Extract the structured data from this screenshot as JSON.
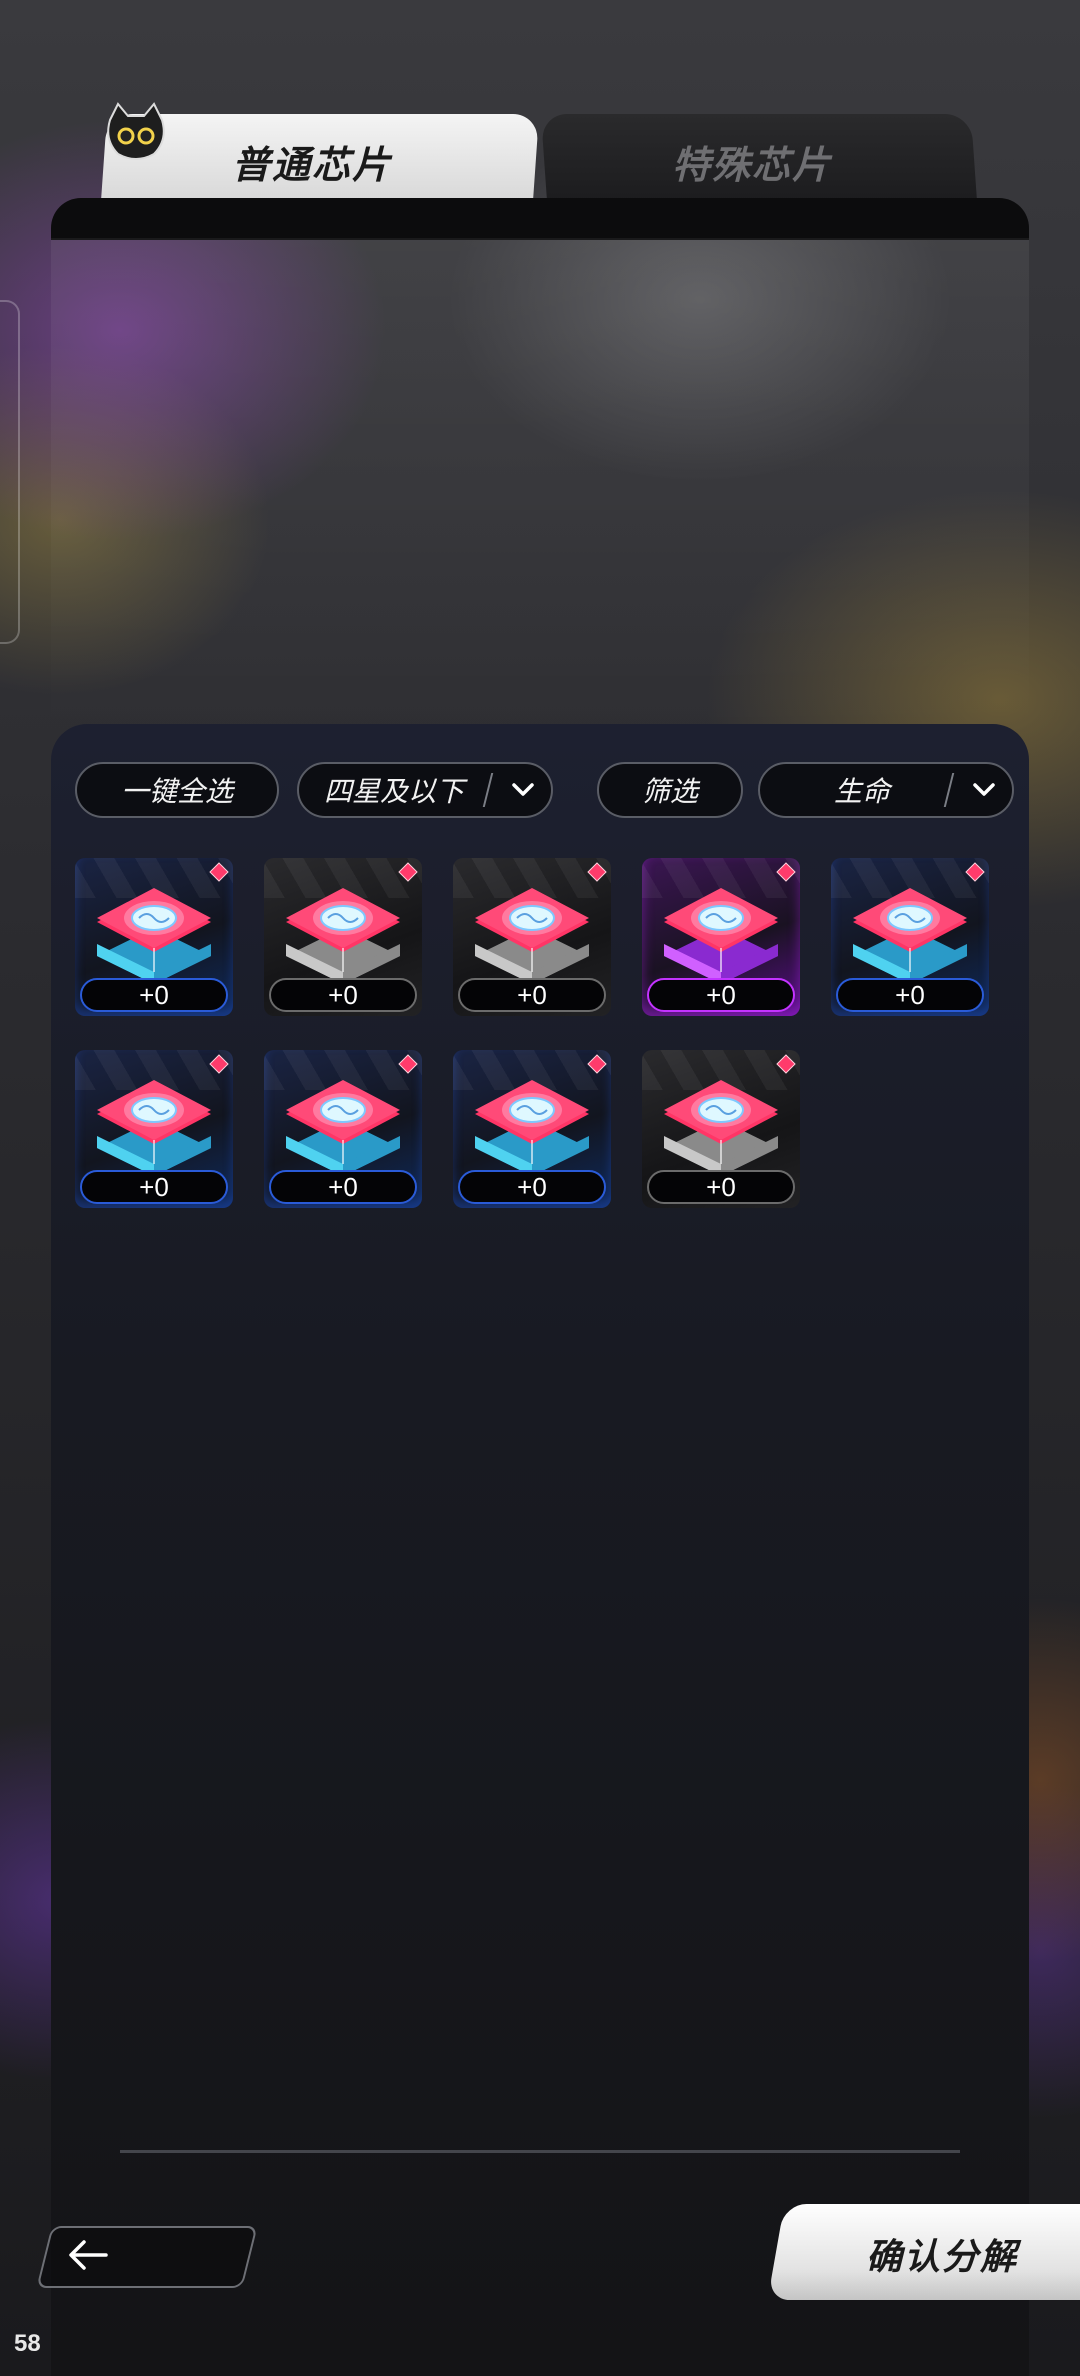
{
  "tabs": [
    {
      "label": "普通芯片",
      "active": true
    },
    {
      "label": "特殊芯片",
      "active": false
    }
  ],
  "filters": {
    "select_all_label": "一键全选",
    "star_filter_label": "四星及以下",
    "filter_label": "筛选",
    "sort_label": "生命"
  },
  "chips": [
    {
      "level": "+0",
      "rarity": "blue"
    },
    {
      "level": "+0",
      "rarity": "gray"
    },
    {
      "level": "+0",
      "rarity": "gray"
    },
    {
      "level": "+0",
      "rarity": "purple"
    },
    {
      "level": "+0",
      "rarity": "blue"
    },
    {
      "level": "+0",
      "rarity": "blue"
    },
    {
      "level": "+0",
      "rarity": "blue"
    },
    {
      "level": "+0",
      "rarity": "blue"
    },
    {
      "level": "+0",
      "rarity": "gray"
    }
  ],
  "actions": {
    "confirm_label": "确认分解"
  },
  "fps_counter": "58",
  "colors": {
    "rarity_blue": "#2a5bd8",
    "rarity_purple": "#c333ff",
    "rarity_gray": "#6b6b6b",
    "gem_pink": "#ff3b6b"
  }
}
